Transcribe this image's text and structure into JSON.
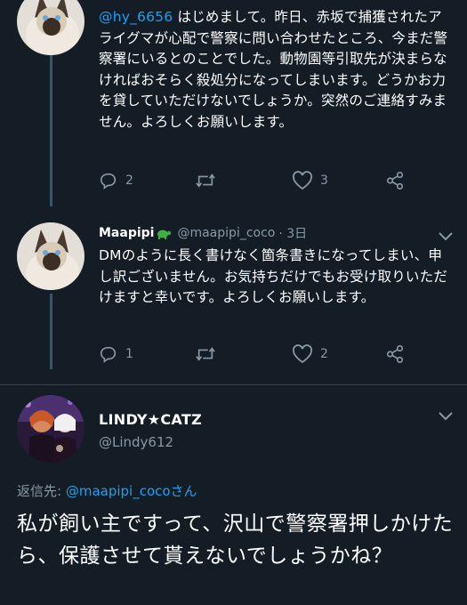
{
  "tweet1": {
    "mention": "@hy_6656",
    "text": "はじめまして。昨日、赤坂で捕獲されたアライグマが心配で警察に問い合わせたところ、今まだ警察署にいるとのことでした。動物園等引取先が決まらなければおそらく殺処分になってしまいます。どうかお力を貸していただけないでしょうか。突然のご連絡すみません。よろしくお願いします。",
    "reply_count": "2",
    "like_count": "3"
  },
  "tweet2": {
    "display_name": "Maapipi",
    "handle": "@maapipi_coco",
    "time": "· 3日",
    "text": "DMのように長く書けなく箇条書きになってしまい、申し訳ございません。お気持ちだけでもお受け取りいただけますと幸いです。よろしくお願いします。",
    "reply_count": "1",
    "like_count": "2"
  },
  "main_tweet": {
    "display_name": "LINDY★CATZ",
    "handle": "@Lindy612",
    "reply_label": "返信先: ",
    "reply_mention": "@maapipi_cocoさん",
    "text": "私が飼い主ですって、沢山で警察署押しかけたら、保護させて貰えないでしょうかね？"
  },
  "colors": {
    "background": "#141d26",
    "accent": "#1da1f2",
    "secondary_text": "#8899a6",
    "divider": "#38444d"
  },
  "icons": [
    "reply-icon",
    "retweet-icon",
    "like-icon",
    "share-icon",
    "chevron-down-icon",
    "turtle-emoji-icon"
  ]
}
